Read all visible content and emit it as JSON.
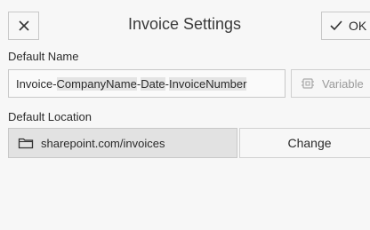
{
  "header": {
    "title": "Invoice Settings",
    "ok_label": "OK"
  },
  "default_name": {
    "label": "Default Name",
    "segments": [
      "Invoice-",
      "CompanyName",
      "-",
      "Date",
      "-",
      "InvoiceNumber"
    ],
    "variable_label": "Variable"
  },
  "default_location": {
    "label": "Default Location",
    "value": "sharepoint.com/invoices",
    "change_label": "Change"
  },
  "icons": {
    "close": "close-icon",
    "ok": "checkmark-icon",
    "variable": "variable-icon",
    "folder": "folder-icon"
  }
}
